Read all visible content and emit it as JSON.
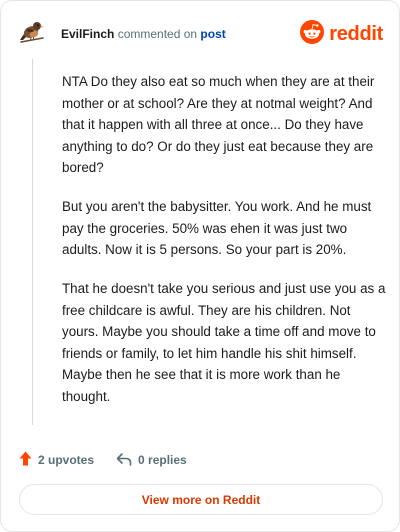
{
  "header": {
    "username": "EvilFinch",
    "action_text": "commented on",
    "post_link": "post",
    "brand": "reddit"
  },
  "comment": {
    "paragraphs": [
      "NTA Do they also eat so much when they are at their mother or at school? Are they at notmal weight? And that it happen with all three at once... Do they have anything to do? Or do they just eat because they are bored?",
      "But you aren't the babysitter. You work. And he must pay the groceries. 50% was ehen it was just two adults. Now it is 5 persons. So your part is 20%.",
      "That he doesn't take you serious and just use you as a free childcare is awful. They are his children. Not yours. Maybe you should take a time off and move to friends or family, to let him handle his shit himself. Maybe then he see that it is more work than he thought."
    ]
  },
  "actions": {
    "upvotes": "2 upvotes",
    "replies": "0 replies"
  },
  "footer": {
    "view_more": "View more on Reddit"
  },
  "colors": {
    "brand": "#ff4500",
    "link": "#0045ac",
    "upvote": "#ff4500",
    "view_more_text": "#d93900"
  },
  "icons": {
    "avatar": "finch-avatar-icon",
    "logo": "reddit-snoo-icon",
    "upvote": "upvote-arrow-icon",
    "reply": "reply-arrow-icon"
  }
}
